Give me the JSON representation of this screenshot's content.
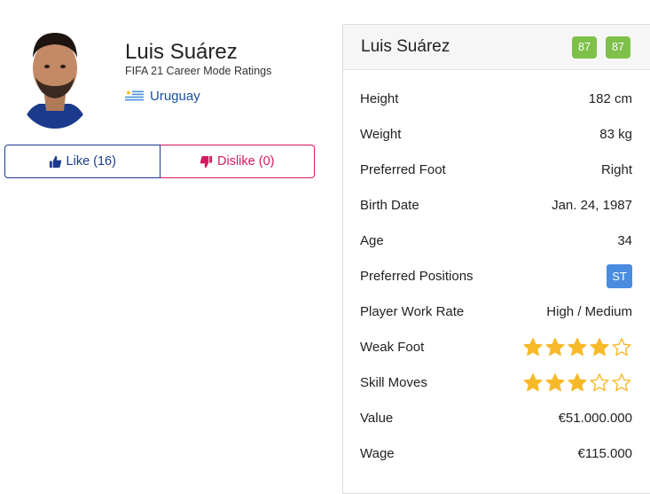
{
  "player": {
    "name": "Luis Suárez",
    "subtitle": "FIFA 21 Career Mode Ratings",
    "nation": "Uruguay",
    "nation_flag_icon": "uruguay-flag-icon"
  },
  "votes": {
    "like_label": "Like (16)",
    "dislike_label": "Dislike (0)",
    "like_color": "#1c3a8c",
    "dislike_color": "#d61a62"
  },
  "card": {
    "title": "Luis Suárez",
    "overall": "87",
    "potential": "87",
    "rating_color": "#7fc04a",
    "rows": [
      {
        "label": "Height",
        "value": "182 cm"
      },
      {
        "label": "Weight",
        "value": "83 kg"
      },
      {
        "label": "Preferred Foot",
        "value": "Right"
      },
      {
        "label": "Birth Date",
        "value": "Jan. 24, 1987"
      },
      {
        "label": "Age",
        "value": "34"
      },
      {
        "label": "Preferred Positions",
        "value": "ST"
      },
      {
        "label": "Player Work Rate",
        "value": "High / Medium"
      },
      {
        "label": "Weak Foot",
        "stars": 4,
        "max": 5
      },
      {
        "label": "Skill Moves",
        "stars": 3,
        "max": 5
      },
      {
        "label": "Value",
        "value": "€51.000.000"
      },
      {
        "label": "Wage",
        "value": "€115.000"
      }
    ],
    "position_color": "#4a8de0",
    "star_color": "#f7b928"
  }
}
